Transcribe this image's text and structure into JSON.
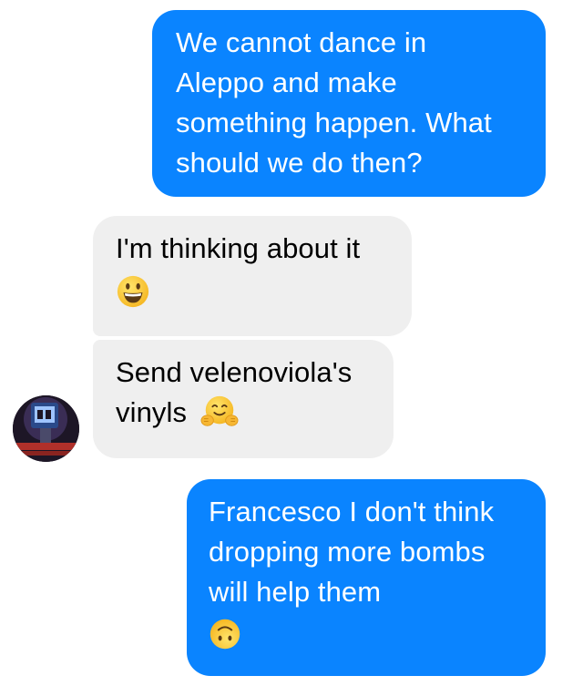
{
  "conversation": {
    "messages": [
      {
        "direction": "sent",
        "lines": [
          "We cannot dance in",
          "Aleppo and make",
          "something happen. What",
          "should we do then?"
        ]
      },
      {
        "direction": "received",
        "lines": [
          "I'm thinking about it"
        ],
        "emoji": "grinning-face-emoji"
      },
      {
        "direction": "received",
        "lines": [
          "Send velenoviola's",
          "vinyls"
        ],
        "emoji": "hugging-face-emoji"
      },
      {
        "direction": "sent",
        "lines": [
          "Francesco I don't think",
          "dropping more bombs",
          "will help them"
        ],
        "emoji": "upside-down-face-emoji"
      }
    ],
    "avatar_icon": "contact-avatar-icon"
  },
  "colors": {
    "sent_bubble": "#0a84ff",
    "received_bubble": "#efefef",
    "sent_text": "#ffffff",
    "received_text": "#000000",
    "emoji_yellow": "#ffcc33"
  }
}
